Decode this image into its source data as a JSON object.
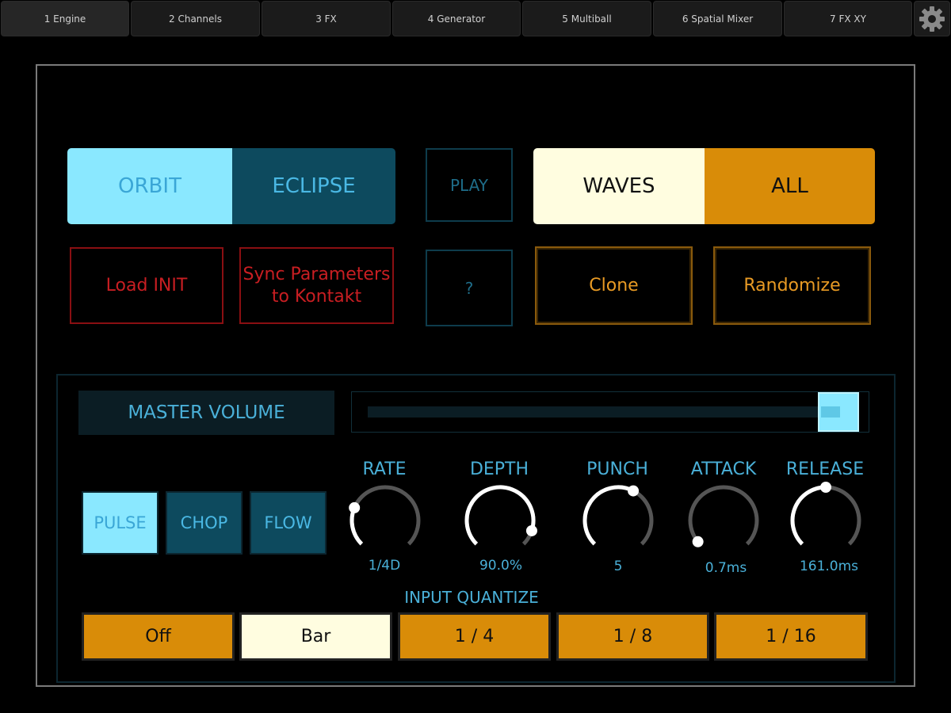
{
  "tabs": [
    {
      "label": "1 Engine",
      "active": true
    },
    {
      "label": "2 Channels"
    },
    {
      "label": "3 FX"
    },
    {
      "label": "4 Generator"
    },
    {
      "label": "5 Multiball"
    },
    {
      "label": "6 Spatial Mixer"
    },
    {
      "label": "7 FX XY"
    }
  ],
  "settings_icon": "gear-icon",
  "top": {
    "orbit": "ORBIT",
    "eclipse": "ECLIPSE",
    "play": "PLAY",
    "waves": "WAVES",
    "all": "ALL",
    "load_init": "Load INIT",
    "sync_line1": "Sync Parameters",
    "sync_line2": "to Kontakt",
    "help": "?",
    "clone": "Clone",
    "randomize": "Randomize"
  },
  "master_volume": {
    "label": "MASTER VOLUME",
    "value_fraction": 0.97
  },
  "modes": [
    "PULSE",
    "CHOP",
    "FLOW"
  ],
  "knobs": [
    {
      "label": "RATE",
      "value": "1/4D",
      "fraction": 0.25
    },
    {
      "label": "DEPTH",
      "value": "90.0%",
      "fraction": 0.9
    },
    {
      "label": "PUNCH",
      "value": "5",
      "fraction": 0.6
    },
    {
      "label": "ATTACK",
      "value": "0.7ms",
      "fraction": 0.02
    },
    {
      "label": "RELEASE",
      "value": "161.0ms",
      "fraction": 0.5
    }
  ],
  "input_quantize": {
    "label": "INPUT QUANTIZE",
    "options": [
      "Off",
      "Bar",
      "1 / 4",
      "1 / 8",
      "1 / 16"
    ],
    "selected": "Bar"
  },
  "colors": {
    "cyan_light": "#8ae8ff",
    "teal_dark": "#0d4a5e",
    "cream": "#fffde0",
    "orange": "#d98c08",
    "red": "#c81e22",
    "text_blue": "#4ab0d8"
  }
}
